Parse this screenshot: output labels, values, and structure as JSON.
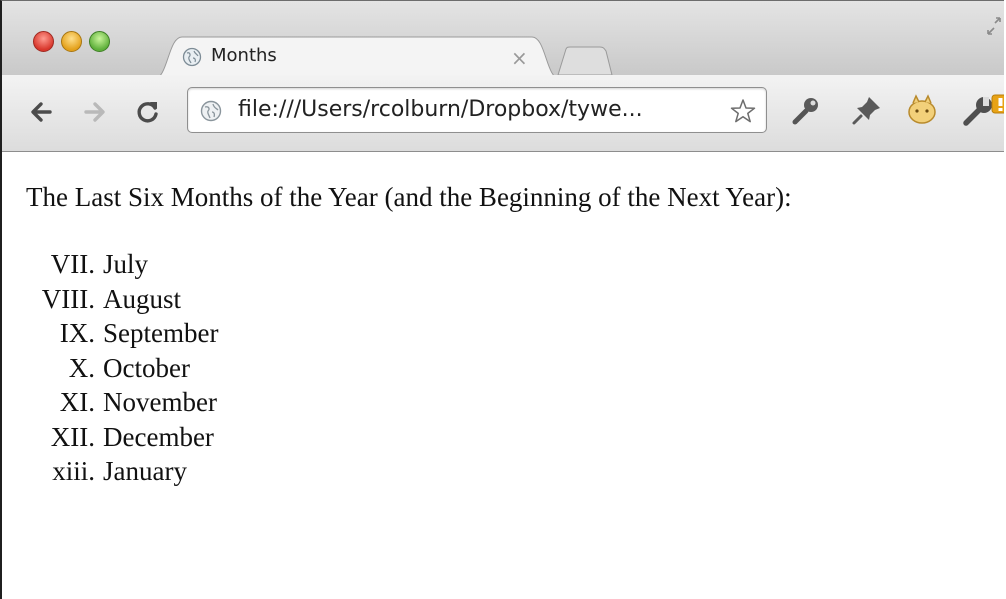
{
  "tab": {
    "title": "Months",
    "close_icon": "close-icon"
  },
  "toolbar": {
    "address": "file:///Users/rcolburn/Dropbox/tywe...",
    "icons": [
      "back-arrow-icon",
      "forward-arrow-icon",
      "reload-icon",
      "globe-icon",
      "star-icon",
      "wrench-key-icon",
      "pin-icon",
      "extension-icon",
      "wrench-icon"
    ]
  },
  "page": {
    "heading": "The Last Six Months of the Year (and the Beginning of the Next Year):",
    "items": [
      {
        "marker": "VII.",
        "label": "July"
      },
      {
        "marker": "VIII.",
        "label": "August"
      },
      {
        "marker": "IX.",
        "label": "September"
      },
      {
        "marker": "X.",
        "label": "October"
      },
      {
        "marker": "XI.",
        "label": "November"
      },
      {
        "marker": "XII.",
        "label": "December"
      },
      {
        "marker": "xiii.",
        "label": "January"
      }
    ]
  },
  "colors": {
    "window_chrome": "#d6d6d6",
    "text": "#111111",
    "notification_badge": "#e8a316"
  }
}
